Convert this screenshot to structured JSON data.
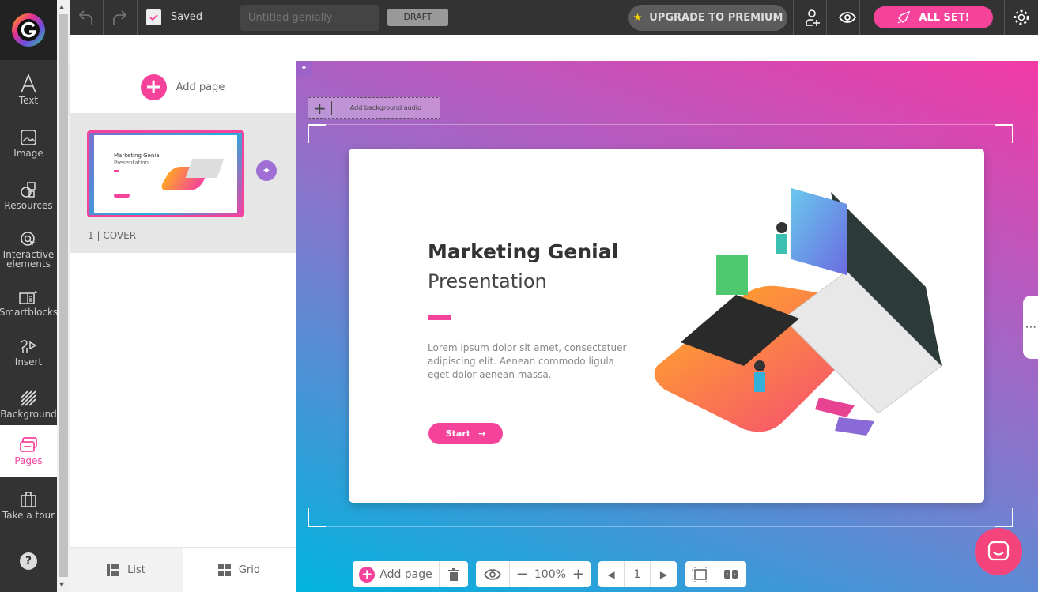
{
  "sidebar": {
    "items": [
      {
        "label": "Text",
        "icon": "text-icon"
      },
      {
        "label": "Image",
        "icon": "image-icon"
      },
      {
        "label": "Resources",
        "icon": "resources-icon"
      },
      {
        "label": "Interactive elements",
        "icon": "interactive-icon"
      },
      {
        "label": "Smartblocks",
        "icon": "smartblocks-icon"
      },
      {
        "label": "Insert",
        "icon": "insert-icon"
      },
      {
        "label": "Background",
        "icon": "background-icon"
      },
      {
        "label": "Pages",
        "icon": "pages-icon",
        "active": true
      },
      {
        "label": "Take a tour",
        "icon": "suitcase-icon"
      }
    ],
    "help": "?"
  },
  "topbar": {
    "saved": "Saved",
    "title_placeholder": "Untitled genially",
    "status": "DRAFT",
    "upgrade": "UPGRADE TO PREMIUM",
    "all_set": "ALL SET!"
  },
  "panel": {
    "add_page": "Add page",
    "pages": [
      {
        "number": "1",
        "name": "COVER"
      }
    ],
    "list": "List",
    "grid": "Grid"
  },
  "canvas": {
    "add_audio": "Add background audio"
  },
  "slide": {
    "title": "Marketing Genial",
    "subtitle": "Presentation",
    "body": "Lorem ipsum dolor sit amet, consectetuer adipiscing elit. Aenean commodo ligula eget dolor aenean massa.",
    "button": "Start"
  },
  "thumb": {
    "title": "Marketing Genial",
    "subtitle": "Presentation"
  },
  "bottombar": {
    "add_page": "Add page",
    "zoom": "100%",
    "page": "1"
  },
  "colors": {
    "accent": "#f5439c",
    "dark": "#333333",
    "purple": "#9f6fd6"
  }
}
